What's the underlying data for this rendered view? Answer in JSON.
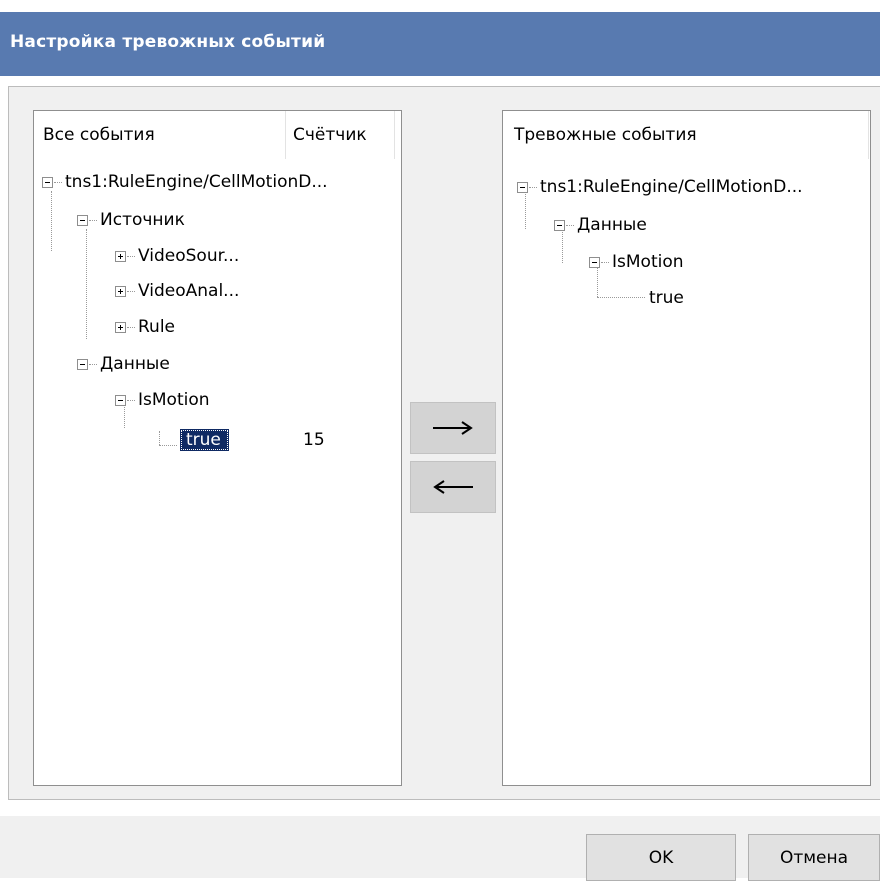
{
  "window": {
    "title": "Настройка тревожных событий"
  },
  "left_tree": {
    "headers": {
      "name": "Все события",
      "counter": "Счётчик"
    },
    "nodes": [
      {
        "label": "tns1:RuleEngine/CellMotionD...",
        "expanded": true
      },
      {
        "label": "Источник",
        "expanded": true
      },
      {
        "label": "VideoSour...",
        "expanded": false
      },
      {
        "label": "VideoAnal...",
        "expanded": false
      },
      {
        "label": "Rule",
        "expanded": false
      },
      {
        "label": "Данные",
        "expanded": true
      },
      {
        "label": "IsMotion",
        "expanded": true
      },
      {
        "label": "true",
        "selected": true,
        "counter": "15"
      }
    ]
  },
  "right_tree": {
    "headers": {
      "name": "Тревожные события"
    },
    "nodes": [
      {
        "label": "tns1:RuleEngine/CellMotionD...",
        "expanded": true
      },
      {
        "label": "Данные",
        "expanded": true
      },
      {
        "label": "IsMotion",
        "expanded": true
      },
      {
        "label": "true"
      }
    ]
  },
  "transfer_buttons": {
    "add_icon": "arrow-right-icon",
    "remove_icon": "arrow-left-icon"
  },
  "buttons": {
    "ok": "OK",
    "cancel": "Отмена"
  },
  "colors": {
    "titlebar": "#587ab0",
    "selection": "#0f2a63",
    "dialog_bg": "#f0f0f0",
    "button_bg": "#e1e1e1",
    "transfer_button_bg": "#d3d3d3"
  }
}
